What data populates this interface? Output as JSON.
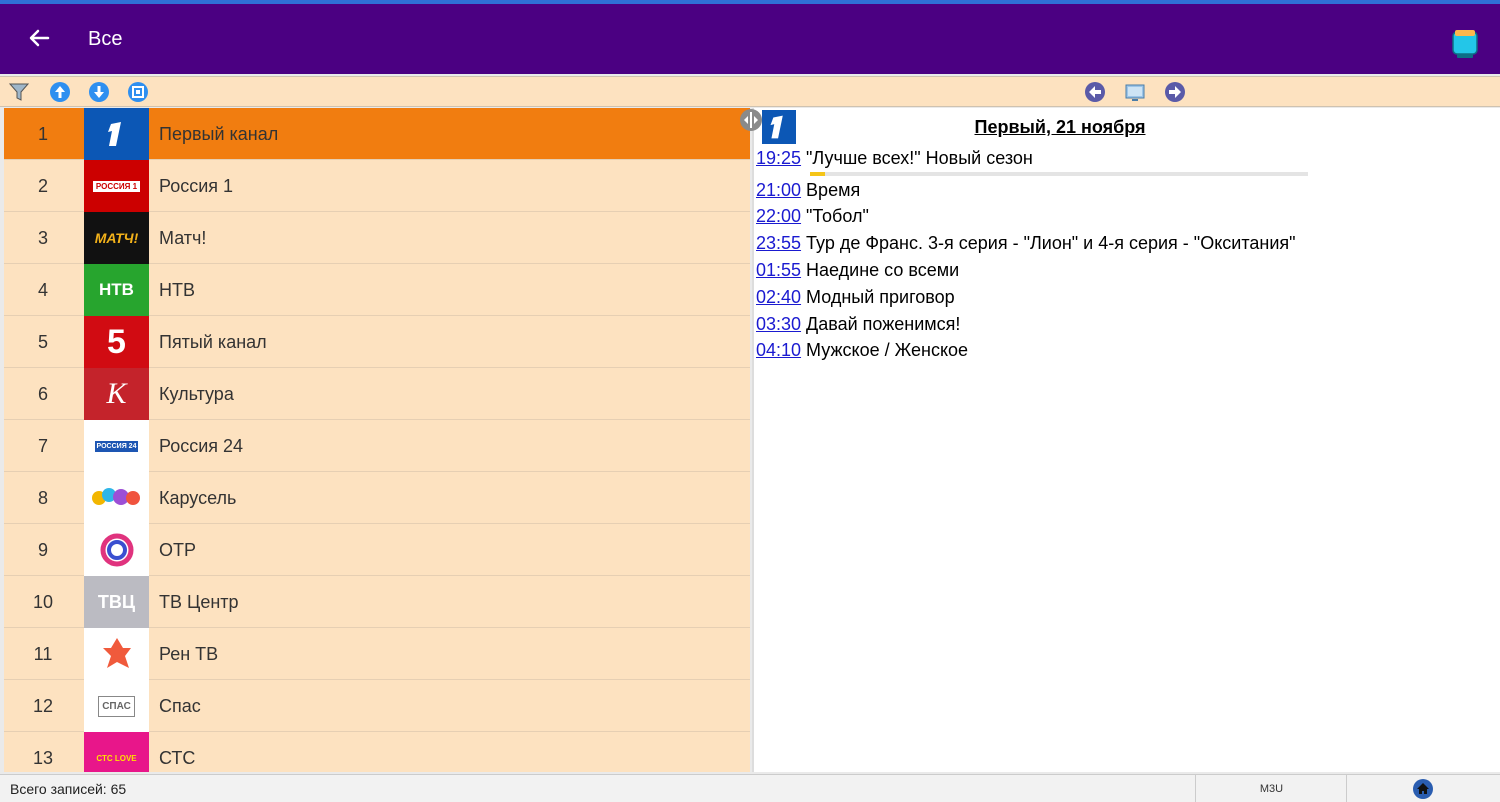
{
  "app_bar": {
    "title": "Все",
    "icons": [
      "back-arrow-icon",
      "tv-icon"
    ],
    "background": "#4b0082"
  },
  "toolbar": {
    "icons": [
      "filter-icon",
      "move-up-icon",
      "move-down-icon",
      "sort-icon",
      "prev-day-icon",
      "tv-guide-icon",
      "next-day-icon"
    ]
  },
  "channels": [
    {
      "num": "1",
      "name": "Первый канал",
      "selected": true
    },
    {
      "num": "2",
      "name": "Россия 1"
    },
    {
      "num": "3",
      "name": "Матч!"
    },
    {
      "num": "4",
      "name": "НТВ"
    },
    {
      "num": "5",
      "name": "Пятый канал"
    },
    {
      "num": "6",
      "name": "Культура"
    },
    {
      "num": "7",
      "name": "Россия 24"
    },
    {
      "num": "8",
      "name": "Карусель"
    },
    {
      "num": "9",
      "name": "ОТР"
    },
    {
      "num": "10",
      "name": "ТВ Центр"
    },
    {
      "num": "11",
      "name": "Рен ТВ"
    },
    {
      "num": "12",
      "name": "Спас"
    },
    {
      "num": "13",
      "name": "СТС"
    }
  ],
  "channel_logos": {
    "ch2": "РОССИЯ 1",
    "ch3": "МАТЧ!",
    "ch4": "НТВ",
    "ch5": "5",
    "ch6": "К",
    "ch7": "РОССИЯ 24",
    "ch10": "ТВЦ",
    "ch12": "СПАС",
    "ch13": "СТС LOVE"
  },
  "epg": {
    "header": "Первый, 21 ноября",
    "current_progress": 0.03,
    "programs": [
      {
        "time": "19:25",
        "title": "\"Лучше всех!\" Новый сезон"
      },
      {
        "time": "21:00",
        "title": "Время"
      },
      {
        "time": "22:00",
        "title": "\"Тобол\""
      },
      {
        "time": "23:55",
        "title": "Тур де Франс. 3-я серия - \"Лион\" и 4-я серия - \"Окситания\""
      },
      {
        "time": "01:55",
        "title": "Наедине со всеми"
      },
      {
        "time": "02:40",
        "title": "Модный приговор"
      },
      {
        "time": "03:30",
        "title": "Давай поженимся!"
      },
      {
        "time": "04:10",
        "title": "Мужское / Женское"
      }
    ]
  },
  "status_bar": {
    "count_text": "Всего записей: 65",
    "m3u_label": "M3U"
  },
  "colors": {
    "selected_row": "#f17d10",
    "list_bg": "#fde2c0",
    "link_time": "#1a1ad0",
    "progress": "#f5c518"
  }
}
